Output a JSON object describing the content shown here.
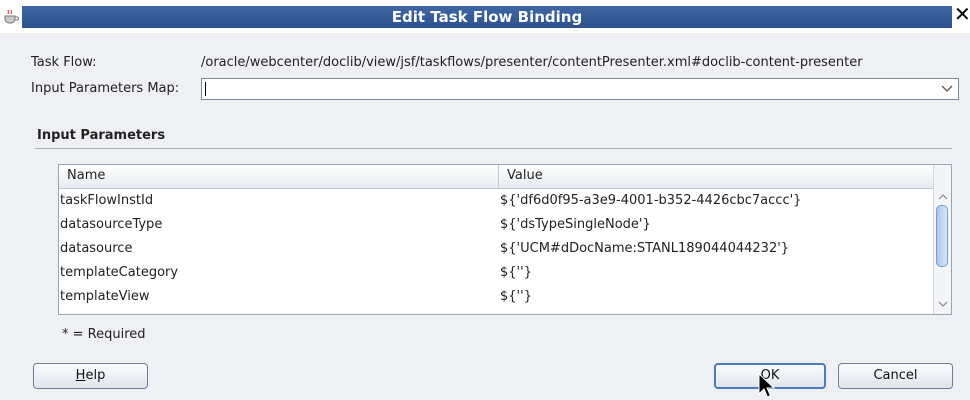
{
  "window": {
    "title": "Edit Task Flow Binding",
    "close_glyph": "✕"
  },
  "form": {
    "task_flow_label": "Task Flow:",
    "task_flow_value": "/oracle/webcenter/doclib/view/jsf/taskflows/presenter/contentPresenter.xml#doclib-content-presenter",
    "input_map_label": "Input Parameters Map:",
    "input_map_value": ""
  },
  "input_parameters": {
    "section_title": "Input Parameters",
    "columns": [
      "Name",
      "Value"
    ],
    "rows": [
      {
        "name": "taskFlowInstId",
        "value": "${'df6d0f95-a3e9-4001-b352-4426cbc7accc'}"
      },
      {
        "name": "datasourceType",
        "value": "${'dsTypeSingleNode'}"
      },
      {
        "name": "datasource",
        "value": "${'UCM#dDocName:STANL189044044232'}"
      },
      {
        "name": "templateCategory",
        "value": "${''}"
      },
      {
        "name": "templateView",
        "value": "${''}"
      }
    ],
    "required_note": "* = Required"
  },
  "buttons": {
    "help_prefix": "",
    "help_mnemonic": "H",
    "help_rest": "elp",
    "ok": "OK",
    "cancel": "Cancel"
  },
  "colors": {
    "title_bar": "#2e528d",
    "dialog_bg": "#eef0f3",
    "scroll_thumb": "#a9c6ea"
  },
  "icons": {
    "app": "java-cup-icon",
    "close": "close-icon",
    "dropdown": "chevron-down-icon",
    "cursor": "mouse-pointer-icon"
  }
}
